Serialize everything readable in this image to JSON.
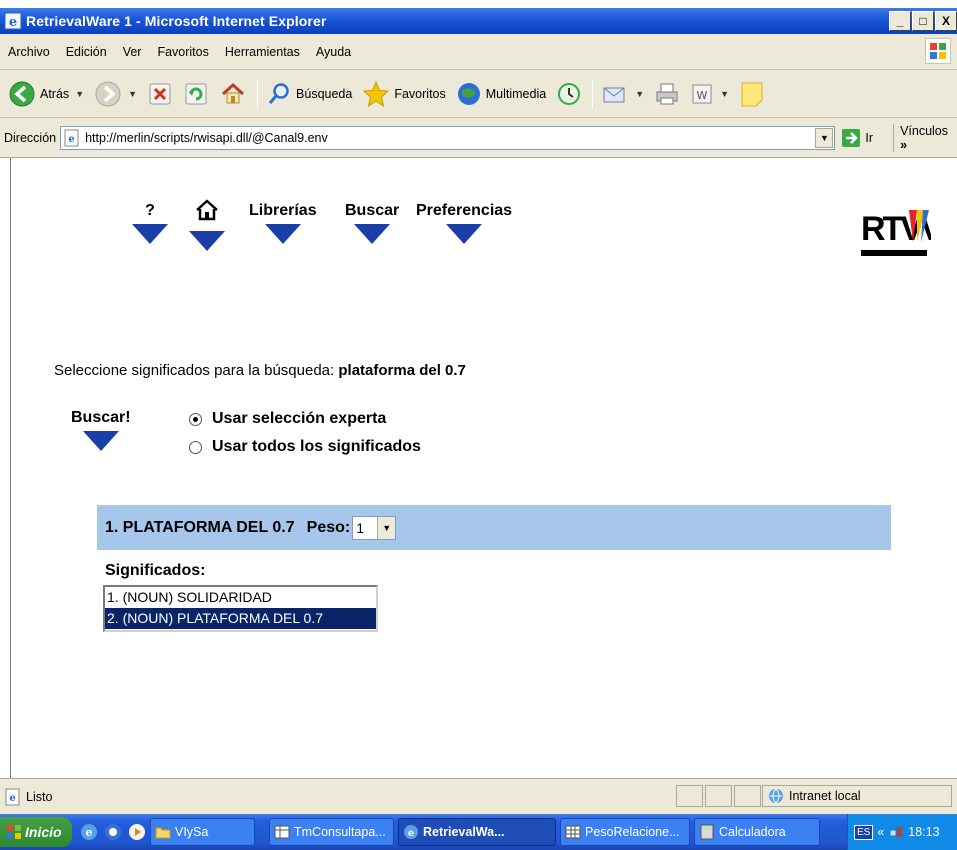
{
  "window": {
    "title": "RetrievalWare 1 - Microsoft Internet Explorer",
    "buttons": [
      "_",
      "□",
      "X"
    ]
  },
  "menubar": {
    "items": [
      "Archivo",
      "Edición",
      "Ver",
      "Favoritos",
      "Herramientas",
      "Ayuda"
    ]
  },
  "toolbar": {
    "back_label": "Atrás",
    "search_label": "Búsqueda",
    "favorites_label": "Favoritos",
    "multimedia_label": "Multimedia"
  },
  "address": {
    "label": "Dirección",
    "url": "http://merlin/scripts/rwisapi.dll/@Canal9.env",
    "go_label": "Ir",
    "links_label": "Vínculos",
    "links_chevron": "»"
  },
  "page": {
    "nav": {
      "help": "?",
      "libraries": "Librerías",
      "search": "Buscar",
      "preferences": "Preferencias"
    },
    "logo_text": "RTVV",
    "prompt_text": "Seleccione significados para la búsqueda: ",
    "query": "plataforma del 0.7",
    "buscar_button": "Buscar!",
    "options": [
      {
        "label": "Usar selección experta",
        "checked": true
      },
      {
        "label": "Usar todos los significados",
        "checked": false
      }
    ],
    "result": {
      "title": "1. PLATAFORMA DEL 0.7",
      "peso_label": "Peso:",
      "peso_value": "1"
    },
    "meanings_label": "Significados:",
    "meanings": [
      {
        "text": "1. (NOUN) SOLIDARIDAD",
        "selected": false
      },
      {
        "text": "2. (NOUN) PLATAFORMA DEL 0.7",
        "selected": true
      }
    ]
  },
  "status": {
    "text": "Listo",
    "zone": "Intranet local"
  },
  "taskbar": {
    "start": "Inicio",
    "tasks": [
      {
        "label": "VIySa",
        "active": false
      },
      {
        "label": "TmConsultapa...",
        "active": false
      },
      {
        "label": "RetrievalWa...",
        "active": true
      },
      {
        "label": "PesoRelacione...",
        "active": false
      },
      {
        "label": "Calculadora",
        "active": false
      }
    ],
    "lang": "ES",
    "chevron": "«",
    "clock": "18:13"
  },
  "colors": {
    "title_blue": "#1856d6",
    "result_bar": "#a6c7eb",
    "nav_arrow": "#1a3fa8",
    "selection": "#0a246a"
  }
}
